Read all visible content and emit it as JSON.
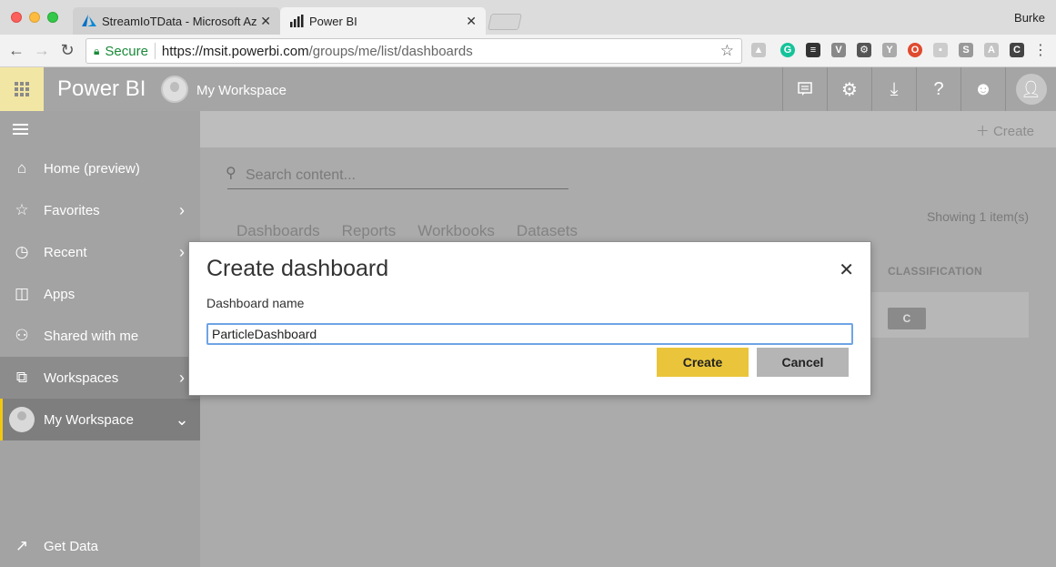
{
  "browser": {
    "tabs": [
      {
        "title": "StreamIoTData - Microsoft Azu",
        "icon": "azure-logo-icon"
      },
      {
        "title": "Power BI",
        "icon": "powerbi-bars-icon"
      }
    ],
    "user": "Burke",
    "address": {
      "secure_label": "Secure",
      "url_host": "https://msit.powerbi.com",
      "url_path": "/groups/me/list/dashboards"
    }
  },
  "header": {
    "brand": "Power BI",
    "workspace": "My Workspace"
  },
  "sidebar": {
    "items": [
      {
        "label": "Home (preview)",
        "icon": "home-icon"
      },
      {
        "label": "Favorites",
        "icon": "star-icon"
      },
      {
        "label": "Recent",
        "icon": "clock-icon"
      },
      {
        "label": "Apps",
        "icon": "apps-icon"
      },
      {
        "label": "Shared with me",
        "icon": "people-icon"
      },
      {
        "label": "Workspaces",
        "icon": "workspaces-icon"
      },
      {
        "label": "My Workspace",
        "icon": "avatar"
      }
    ],
    "get_data": "Get Data"
  },
  "main": {
    "create_label": "Create",
    "search_placeholder": "Search content...",
    "showing": "Showing 1 item(s)",
    "tabs": [
      "Dashboards",
      "Reports",
      "Workbooks",
      "Datasets"
    ],
    "classification_header": "CLASSIFICATION",
    "classification_value": "C"
  },
  "dialog": {
    "title": "Create dashboard",
    "field_label": "Dashboard name",
    "field_value": "ParticleDashboard",
    "create_button": "Create",
    "cancel_button": "Cancel"
  },
  "colors": {
    "accent_yellow": "#eac53b",
    "sidebar_gray": "#a3a3a3",
    "input_focus": "#6fa4e6"
  }
}
